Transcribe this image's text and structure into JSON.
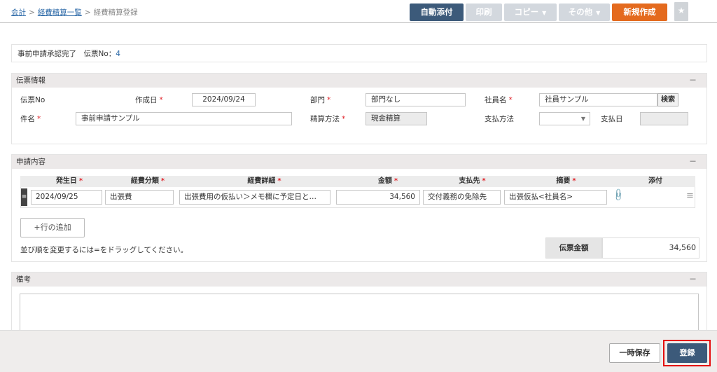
{
  "breadcrumb": {
    "item1": "会計",
    "sep": ">",
    "item2": "経費精算一覧",
    "item3": "経費精算登録"
  },
  "toolbar": {
    "auto_attach": "自動添付",
    "print": "印刷",
    "copy": "コピー",
    "other": "その他",
    "new": "新規作成",
    "caret": "▼",
    "star": "★"
  },
  "status": {
    "text": "事前申請承認完了　伝票No：",
    "no": "4"
  },
  "info": {
    "title": "伝票情報",
    "collapse": "－",
    "slip_no_label": "伝票No",
    "created_label": "作成日",
    "created_value": "2024/09/24",
    "dept_label": "部門",
    "dept_value": "部門なし",
    "employee_label": "社員名",
    "employee_value": "社員サンプル",
    "search": "検索",
    "subject_label": "件名",
    "subject_value": "事前申請サンプル",
    "method_label": "精算方法",
    "method_value": "現金精算",
    "pay_method_label": "支払方法",
    "pay_method_value": "",
    "pay_date_label": "支払日",
    "pay_date_value": "",
    "required_mark": "*"
  },
  "detail": {
    "title": "申請内容",
    "collapse": "－",
    "columns": [
      "発生日",
      "経費分類",
      "経費詳細",
      "金額",
      "支払先",
      "摘要",
      "添付"
    ],
    "required_mark": "*",
    "row": {
      "handle": "≡",
      "date": "2024/09/25",
      "category": "出張費",
      "detail": "出張費用の仮払い＞メモ欄に予定日と…",
      "amount": "34,560",
      "payee": "交付義務の免除先",
      "summary": "出張仮払<社員名>",
      "attach_icon": "paperclip-icon",
      "drag": "≡"
    },
    "add_row": "+行の追加",
    "hint": "並び順を変更するには=をドラッグしてください。",
    "total_label": "伝票金額",
    "total_value": "34,560"
  },
  "note": {
    "title": "備考",
    "collapse": "－",
    "value": ""
  },
  "footer": {
    "temp_save": "一時保存",
    "register": "登録"
  },
  "colors": {
    "navy": "#3c5a7a",
    "orange": "#e46a1e",
    "disabled": "#d3d8de",
    "highlight": "#e40d0d",
    "link": "#2d6aa8"
  }
}
